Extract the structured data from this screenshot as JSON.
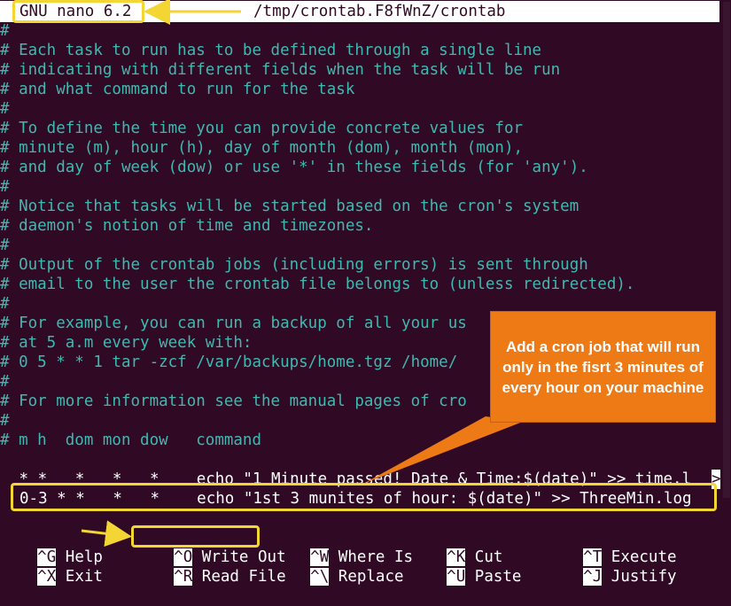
{
  "titlebar": {
    "app": "GNU nano 6.2",
    "file": "/tmp/crontab.F8fWnZ/crontab"
  },
  "editor_lines": [
    "#",
    "# Each task to run has to be defined through a single line",
    "# indicating with different fields when the task will be run",
    "# and what command to run for the task",
    "#",
    "# To define the time you can provide concrete values for",
    "# minute (m), hour (h), day of month (dom), month (mon),",
    "# and day of week (dow) or use '*' in these fields (for 'any').",
    "#",
    "# Notice that tasks will be started based on the cron's system",
    "# daemon's notion of time and timezones.",
    "#",
    "# Output of the crontab jobs (including errors) is sent through",
    "# email to the user the crontab file belongs to (unless redirected).",
    "#",
    "# For example, you can run a backup of all your us",
    "# at 5 a.m every week with:",
    "# 0 5 * * 1 tar -zcf /var/backups/home.tgz /home/",
    "#",
    "# For more information see the manual pages of cro",
    "#",
    "# m h  dom mon dow   command",
    "",
    " * *   *   *   *    echo \"1 Minute passed! Date & Time:$(date)\" >> time.l",
    "0-3 * *   *   *    echo \"1st 3 munites of hour: $(date)\" >> ThreeMin.log"
  ],
  "overflow_marker": ">",
  "callout_text": "Add a cron job that will run only in the fisrt 3 minutes of every hour on your machine",
  "shortcuts_row1": [
    {
      "key": "^G",
      "label": "Help"
    },
    {
      "key": "^O",
      "label": "Write Out"
    },
    {
      "key": "^W",
      "label": "Where Is"
    },
    {
      "key": "^K",
      "label": "Cut"
    },
    {
      "key": "^T",
      "label": "Execute"
    }
  ],
  "shortcuts_row2": [
    {
      "key": "^X",
      "label": "Exit"
    },
    {
      "key": "^R",
      "label": "Read File"
    },
    {
      "key": "^\\",
      "label": "Replace"
    },
    {
      "key": "^U",
      "label": "Paste"
    },
    {
      "key": "^J",
      "label": "Justify"
    }
  ],
  "colors": {
    "background": "#300a24",
    "comment": "#3fb8b0",
    "highlight": "#f3d534",
    "callout": "#ee7a16"
  }
}
